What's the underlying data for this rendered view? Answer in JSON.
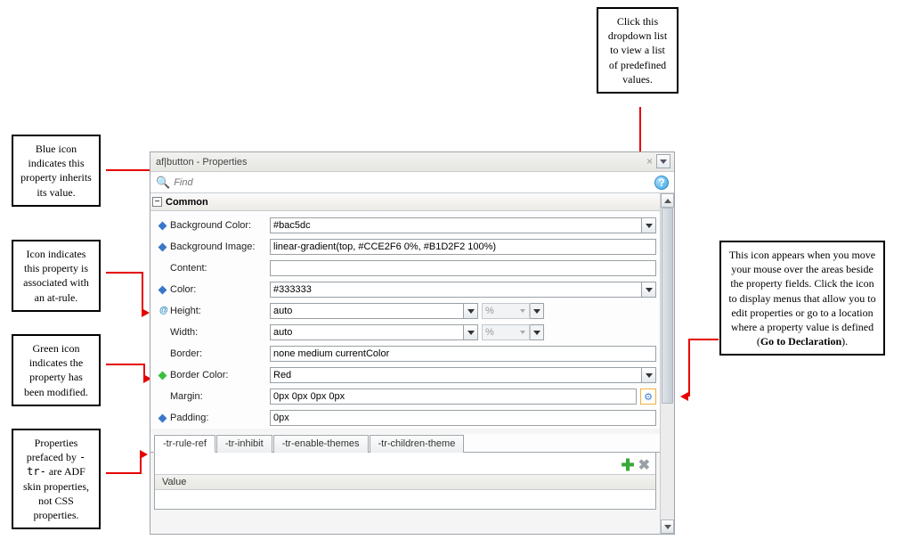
{
  "callouts": {
    "top": "Click this dropdown list to view a list of predefined values.",
    "blue": "Blue icon indicates this property inherits its value.",
    "atrule": "Icon indicates this property is associated with an at-rule.",
    "green": "Green icon indicates the property has been modified.",
    "tr": "Properties prefaced by -tr- are ADF skin properties, not CSS properties.",
    "right_pre": "This icon appears when you move your mouse over the areas beside the property fields. Click the icon to display menus that allow you to edit properties or go to a location where a property value is defined (",
    "right_bold": "Go to Declaration",
    "right_post": ")."
  },
  "panel": {
    "title": "af|button - Properties",
    "find_placeholder": "Find",
    "help_glyph": "?",
    "section": "Common",
    "unit_pct": "%",
    "props": {
      "bgcolor": {
        "label": "Background Color:",
        "value": "#bac5dc"
      },
      "bgimage": {
        "label": "Background Image:",
        "value": "linear-gradient(top, #CCE2F6 0%, #B1D2F2 100%)"
      },
      "content": {
        "label": "Content:",
        "value": ""
      },
      "color": {
        "label": "Color:",
        "value": "#333333"
      },
      "height": {
        "label": "Height:",
        "value": "auto"
      },
      "width": {
        "label": "Width:",
        "value": "auto"
      },
      "border": {
        "label": "Border:",
        "value": "none medium currentColor"
      },
      "bordercolor": {
        "label": "Border Color:",
        "value": "Red"
      },
      "margin": {
        "label": "Margin:",
        "value": "0px 0px 0px 0px"
      },
      "padding": {
        "label": "Padding:",
        "value": "0px"
      }
    },
    "tabs": [
      "-tr-rule-ref",
      "-tr-inhibit",
      "-tr-enable-themes",
      "-tr-children-theme"
    ],
    "subheader": "Value",
    "gear_glyph": "⚙"
  }
}
